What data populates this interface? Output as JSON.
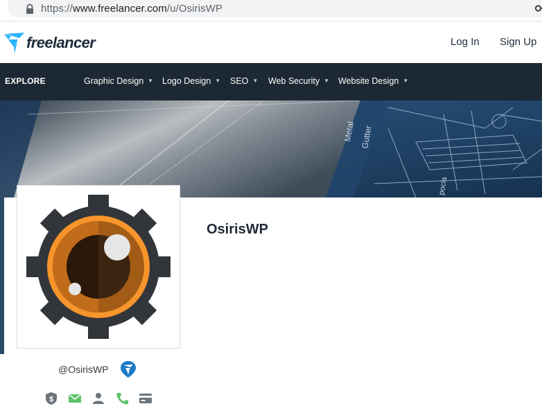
{
  "browser": {
    "url_prefix": "https://",
    "url_host": "www.freelancer.com",
    "url_path": "/u/OsirisWP"
  },
  "header": {
    "logo_text": "freelancer",
    "login_label": "Log In",
    "signup_label": "Sign Up"
  },
  "nav": {
    "explore_label": "EXPLORE",
    "items": [
      {
        "label": "Graphic Design"
      },
      {
        "label": "Logo Design"
      },
      {
        "label": "SEO"
      },
      {
        "label": "Web Security"
      },
      {
        "label": "Website Design"
      }
    ]
  },
  "banner": {
    "texts": [
      "Metal",
      "Gutter",
      "pocia"
    ]
  },
  "profile": {
    "display_name": "OsirisWP",
    "handle": "@OsirisWP",
    "verifications": [
      {
        "icon": "payment-verified-icon"
      },
      {
        "icon": "email-verified-icon"
      },
      {
        "icon": "profile-verified-icon"
      },
      {
        "icon": "phone-verified-icon"
      },
      {
        "icon": "deposit-verified-icon"
      }
    ]
  },
  "colors": {
    "brand_blue": "#29b2fe",
    "nav_bg": "#1c2833",
    "verified_green": "#5dc26a",
    "unverified_gray": "#6c737b",
    "gear": "#32363a",
    "eye_orange": "#f7952c"
  }
}
